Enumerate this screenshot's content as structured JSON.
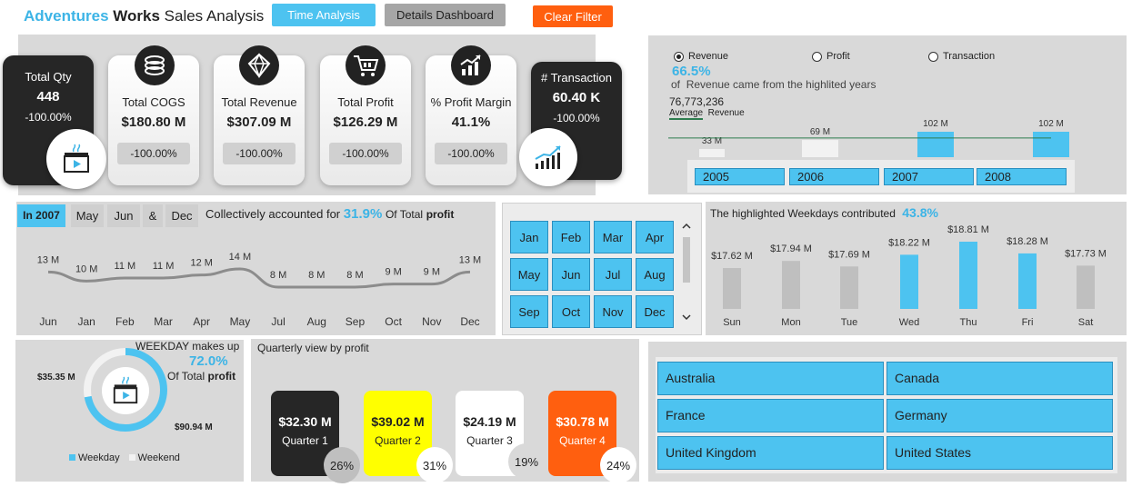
{
  "header": {
    "title_part1": "Adventures",
    "title_part2": "Works",
    "title_part3": "Sales Analysis",
    "buttons": {
      "time_analysis": "Time Analysis",
      "details_dashboard": "Details Dashboard",
      "clear_filter": "Clear Filter"
    }
  },
  "colors": {
    "accent_blue": "#4dc3f0",
    "highlight_text": "#3cb4e6",
    "orange": "#ff5f0f",
    "yellow": "#ffff00",
    "dark": "#262626",
    "panel": "#d9d9d9"
  },
  "kpis": [
    {
      "title": "Total Qty",
      "value": "448",
      "pct": "-100.00%"
    },
    {
      "title": "Total COGS",
      "value": "$180.80 M",
      "pct": "-100.00%"
    },
    {
      "title": "Total Revenue",
      "value": "$307.09 M",
      "pct": "-100.00%"
    },
    {
      "title": "Total Profit",
      "value": "$126.29 M",
      "pct": "-100.00%"
    },
    {
      "title": "% Profit Margin",
      "value": "41.1%",
      "pct": "-100.00%"
    },
    {
      "title": "# Transaction",
      "value": "60.40 K",
      "pct": "-100.00%"
    }
  ],
  "revenue_panel": {
    "radios": [
      "Revenue",
      "Profit",
      "Transaction"
    ],
    "selected": "Revenue",
    "pct": "66.5%",
    "caption_of": "of",
    "caption_text": "Revenue came from the highlited years",
    "avg_value": "76,773,236",
    "avg_label1": "Average",
    "avg_label2": "Revenue",
    "years": [
      "2005",
      "2006",
      "2007",
      "2008"
    ]
  },
  "year_chart": {
    "type": "bar",
    "categories": [
      "2005",
      "2006",
      "2007",
      "2008"
    ],
    "values": [
      33,
      69,
      102,
      102
    ],
    "labels": [
      "33 M",
      "69 M",
      "102 M",
      "102 M"
    ],
    "highlighted": [
      false,
      false,
      true,
      true
    ],
    "average": 76.77
  },
  "monthly_panel": {
    "year_tag": "In 2007",
    "months_selected": [
      "May",
      "Jun",
      "&",
      "Dec"
    ],
    "caption": "Collectively accounted for",
    "pct": "31.9%",
    "caption_suffix": "Of Total",
    "caption_bold": "profit"
  },
  "monthly_chart": {
    "type": "line",
    "categories": [
      "Jun",
      "Jan",
      "Feb",
      "Mar",
      "Apr",
      "May",
      "Jul",
      "Aug",
      "Sep",
      "Oct",
      "Nov",
      "Dec"
    ],
    "values": [
      13,
      10,
      11,
      11,
      12,
      14,
      8,
      8,
      8,
      9,
      9,
      13
    ],
    "labels": [
      "13 M",
      "10 M",
      "11 M",
      "11 M",
      "12 M",
      "14 M",
      "8 M",
      "8 M",
      "8 M",
      "9 M",
      "9 M",
      "13 M"
    ]
  },
  "month_slicer": {
    "months": [
      "Jan",
      "Feb",
      "Mar",
      "Apr",
      "May",
      "Jun",
      "Jul",
      "Aug",
      "Sep",
      "Oct",
      "Nov",
      "Dec"
    ]
  },
  "weekday_panel": {
    "caption": "The highlighted Weekdays contributed",
    "pct": "43.8%"
  },
  "weekday_chart": {
    "type": "bar",
    "categories": [
      "Sun",
      "Mon",
      "Tue",
      "Wed",
      "Thu",
      "Fri",
      "Sat"
    ],
    "values": [
      17.62,
      17.94,
      17.69,
      18.22,
      18.81,
      18.28,
      17.73
    ],
    "labels": [
      "$17.62 M",
      "$17.94 M",
      "$17.69 M",
      "$18.22 M",
      "$18.81 M",
      "$18.28 M",
      "$17.73 M"
    ],
    "highlighted": [
      false,
      false,
      false,
      true,
      true,
      true,
      false
    ]
  },
  "donut_panel": {
    "caption": "WEEKDAY makes up",
    "pct": "72.0%",
    "caption_suffix": "Of Total",
    "caption_bold": "profit"
  },
  "donut_chart": {
    "type": "pie",
    "categories": [
      "Weekday",
      "Weekend"
    ],
    "values": [
      90.94,
      35.35
    ],
    "labels": [
      "$90.94 M",
      "$35.35 M"
    ]
  },
  "quarter_panel": {
    "title": "Quarterly view by profit",
    "quarters": [
      {
        "value": "$32.30 M",
        "label": "Quarter 1",
        "pct": "26%"
      },
      {
        "value": "$39.02 M",
        "label": "Quarter 2",
        "pct": "31%"
      },
      {
        "value": "$24.19 M",
        "label": "Quarter 3",
        "pct": "19%"
      },
      {
        "value": "$30.78 M",
        "label": "Quarter 4",
        "pct": "24%"
      }
    ]
  },
  "country_slicer": {
    "countries": [
      "Australia",
      "Canada",
      "France",
      "Germany",
      "United Kingdom",
      "United States"
    ]
  }
}
